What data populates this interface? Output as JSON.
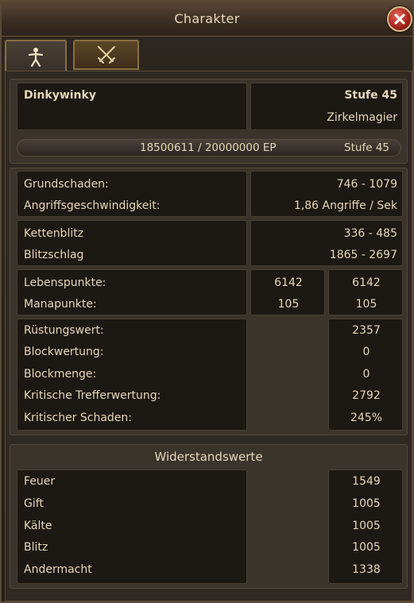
{
  "window": {
    "title": "Charakter"
  },
  "tabs": [
    {
      "icon": "character-figure-icon"
    },
    {
      "icon": "crossed-swords-icon"
    }
  ],
  "profile": {
    "name": "Dinkywinky",
    "level_label": "Stufe 45",
    "class": "Zirkelmagier",
    "xp_text": "18500611  /  20000000  EP",
    "xp_level": "Stufe  45",
    "xp_progress": 0.925
  },
  "damage": {
    "base_label": "Grundschaden:",
    "base_value": "746  -  1079",
    "speed_label": "Angriffsgeschwindigkeit:",
    "speed_value": "1,86  Angriffe  /  Sek"
  },
  "skills": {
    "skill1_label": "Kettenblitz",
    "skill1_value": "336  -  485",
    "skill2_label": "Blitzschlag",
    "skill2_value": "1865  -  2697"
  },
  "vitals": {
    "life_label": "Lebenspunkte:",
    "life_a": "6142",
    "life_b": "6142",
    "mana_label": "Manapunkte:",
    "mana_a": "105",
    "mana_b": "105"
  },
  "defense": {
    "armor_label": "Rüstungswert:",
    "armor_value": "2357",
    "block_rating_label": "Blockwertung:",
    "block_rating_value": "0",
    "block_amount_label": "Blockmenge:",
    "block_amount_value": "0",
    "crit_rating_label": "Kritische  Trefferwertung:",
    "crit_rating_value": "2792",
    "crit_damage_label": "Kritischer  Schaden:",
    "crit_damage_value": "245%"
  },
  "resistances": {
    "title": "Widerstandswerte",
    "fire_label": "Feuer",
    "fire_value": "1549",
    "poison_label": "Gift",
    "poison_value": "1005",
    "cold_label": "Kälte",
    "cold_value": "1005",
    "lightning_label": "Blitz",
    "lightning_value": "1005",
    "othermight_label": "Andermacht",
    "othermight_value": "1338"
  },
  "colors": {
    "text": "#e7d8b8",
    "panel": "#1c1814",
    "accent": "#8a6e44",
    "close": "#a6271f"
  }
}
